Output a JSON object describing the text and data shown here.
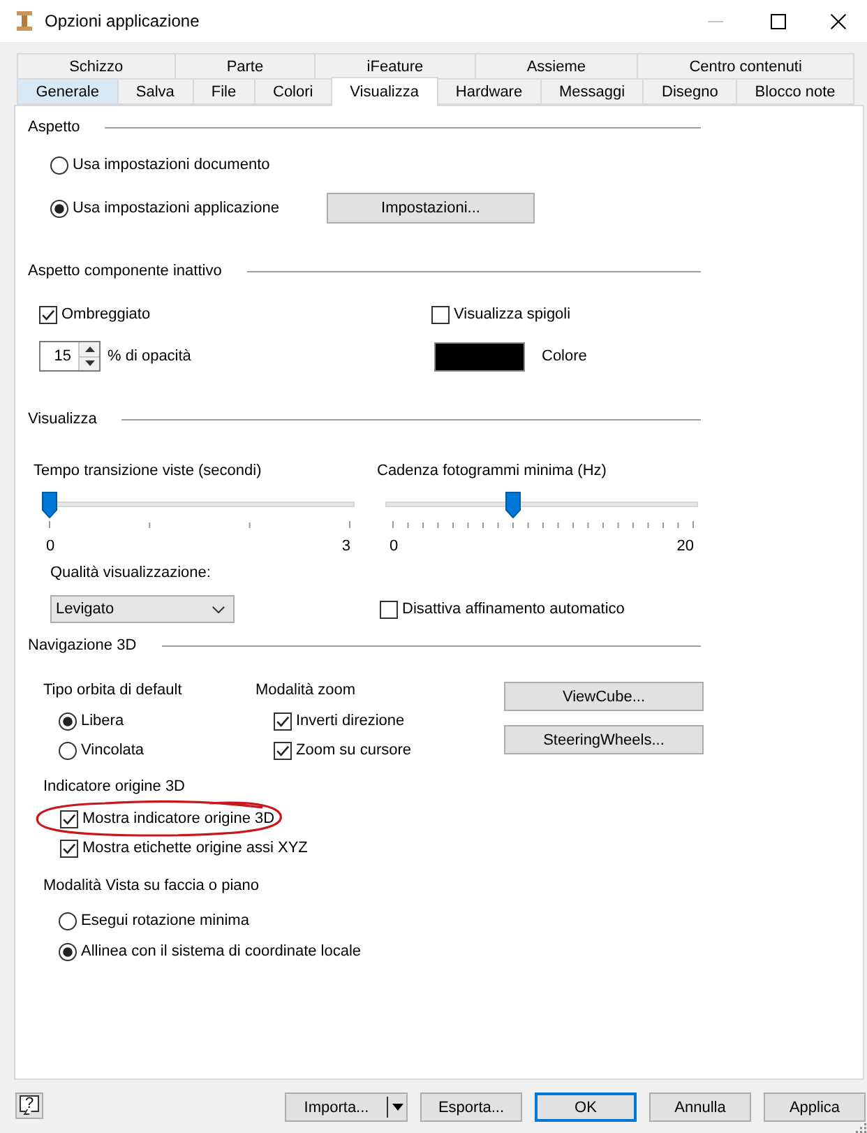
{
  "window": {
    "title": "Opzioni applicazione"
  },
  "tabs": {
    "back_row": [
      {
        "label": "Schizzo",
        "selected": false,
        "hovered": false
      },
      {
        "label": "Parte",
        "selected": false,
        "hovered": false
      },
      {
        "label": "iFeature",
        "selected": false,
        "hovered": false
      },
      {
        "label": "Assieme",
        "selected": false,
        "hovered": false
      },
      {
        "label": "Centro contenuti",
        "selected": false,
        "hovered": false
      }
    ],
    "front_row": [
      {
        "label": "Generale",
        "selected": false,
        "hovered": true
      },
      {
        "label": "Salva",
        "selected": false,
        "hovered": false
      },
      {
        "label": "File",
        "selected": false,
        "hovered": false
      },
      {
        "label": "Colori",
        "selected": false,
        "hovered": false
      },
      {
        "label": "Visualizza",
        "selected": true,
        "hovered": false
      },
      {
        "label": "Hardware",
        "selected": false,
        "hovered": false
      },
      {
        "label": "Messaggi",
        "selected": false,
        "hovered": false
      },
      {
        "label": "Disegno",
        "selected": false,
        "hovered": false
      },
      {
        "label": "Blocco note",
        "selected": false,
        "hovered": false
      }
    ]
  },
  "appearance": {
    "heading": "Aspetto",
    "options": [
      {
        "label": "Usa impostazioni documento",
        "selected": false
      },
      {
        "label": "Usa impostazioni applicazione",
        "selected": true
      }
    ],
    "settings_button": "Impostazioni..."
  },
  "inactive_component": {
    "heading": "Aspetto componente inattivo",
    "shaded": {
      "label": "Ombreggiato",
      "checked": true
    },
    "show_edges": {
      "label": "Visualizza spigoli",
      "checked": false
    },
    "opacity": {
      "value": "15",
      "label": "% di opacità"
    },
    "color": {
      "label": "Colore",
      "color": "#000000"
    }
  },
  "display": {
    "heading": "Visualizza",
    "sliders": [
      {
        "label": "Tempo transizione viste (secondi)",
        "level": 0,
        "min_label": "0",
        "max_label": "3"
      },
      {
        "label": "Cadenza fotogrammi minima (Hz)",
        "level": 0.4,
        "min_label": "0",
        "max_label": "20"
      }
    ],
    "quality": {
      "label": "Qualità visualizzazione:",
      "value": "Levigato"
    },
    "disable_auto_refine": {
      "label": "Disattiva affinamento automatico",
      "checked": false
    }
  },
  "navigation_3d": {
    "heading": "Navigazione 3D",
    "orbit": {
      "heading": "Tipo orbita di default",
      "options": [
        {
          "label": "Libera",
          "selected": true
        },
        {
          "label": "Vincolata",
          "selected": false
        }
      ]
    },
    "zoom": {
      "heading": "Modalità zoom",
      "options": [
        {
          "label": "Inverti direzione",
          "checked": true
        },
        {
          "label": "Zoom su cursore",
          "checked": true
        }
      ]
    },
    "buttons": [
      "ViewCube...",
      "SteeringWheels..."
    ],
    "origin_indicator": {
      "heading": "Indicatore origine 3D",
      "options": [
        {
          "label": "Mostra indicatore origine 3D",
          "checked": true
        },
        {
          "label": "Mostra etichette origine assi XYZ",
          "checked": true
        }
      ]
    },
    "face_view": {
      "heading": "Modalità Vista su faccia o piano",
      "options": [
        {
          "label": "Esegui rotazione minima",
          "selected": false
        },
        {
          "label": "Allinea con il sistema di coordinate locale",
          "selected": true
        }
      ]
    }
  },
  "footer": {
    "help": "?",
    "buttons": [
      {
        "label": "Importa...",
        "kind": "split"
      },
      {
        "label": "Esporta...",
        "kind": "plain"
      },
      {
        "label": "OK",
        "kind": "default"
      },
      {
        "label": "Annulla",
        "kind": "plain"
      },
      {
        "label": "Applica",
        "kind": "plain"
      }
    ]
  }
}
